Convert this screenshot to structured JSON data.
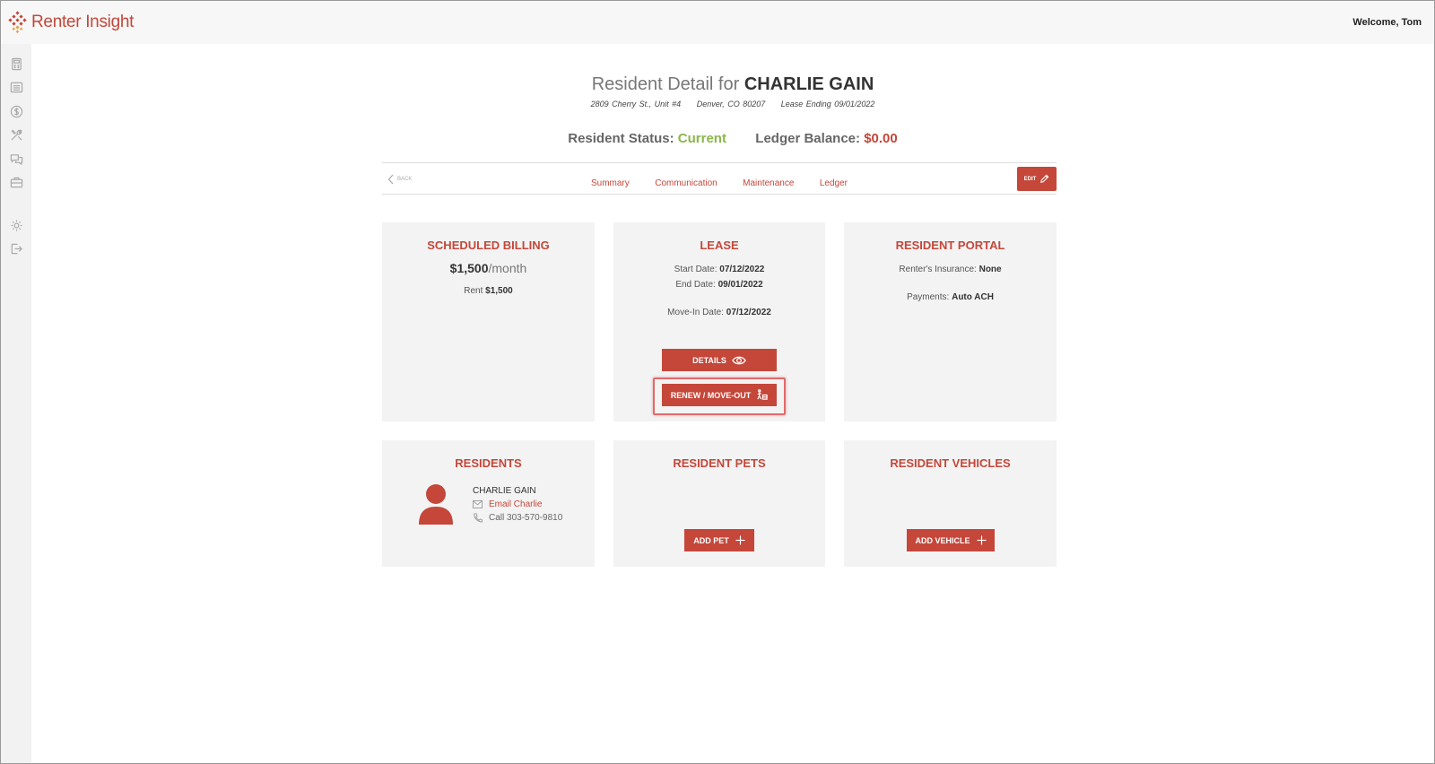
{
  "app": {
    "logo_text": "Renter Insight",
    "welcome": "Welcome, Tom"
  },
  "header": {
    "title_prefix": "Resident Detail for",
    "resident_name": "CHARLIE GAIN",
    "address": "2809 Cherry St., Unit #4",
    "city": "Denver, CO 80207",
    "lease_ending": "Lease Ending 09/01/2022",
    "status_label": "Resident Status:",
    "status_value": "Current",
    "balance_label": "Ledger Balance:",
    "balance_value": "$0.00"
  },
  "nav": {
    "back_label": "BACK",
    "tabs": [
      {
        "label": "Summary"
      },
      {
        "label": "Communication"
      },
      {
        "label": "Maintenance"
      },
      {
        "label": "Ledger"
      }
    ],
    "edit_label": "EDIT"
  },
  "billing": {
    "title": "SCHEDULED BILLING",
    "amount": "$1,500",
    "period": "/month",
    "rent_label": "Rent",
    "rent_value": "$1,500"
  },
  "lease": {
    "title": "LEASE",
    "start_label": "Start Date:",
    "start_value": "07/12/2022",
    "end_label": "End Date:",
    "end_value": "09/01/2022",
    "movein_label": "Move-In Date:",
    "movein_value": "07/12/2022",
    "details_button": "DETAILS",
    "renew_button": "RENEW / MOVE-OUT"
  },
  "portal": {
    "title": "RESIDENT PORTAL",
    "insurance_label": "Renter's Insurance:",
    "insurance_value": "None",
    "payments_label": "Payments:",
    "payments_value": "Auto ACH"
  },
  "residents": {
    "title": "RESIDENTS",
    "name": "CHARLIE GAIN",
    "email_link": "Email Charlie",
    "call_text": "Call 303-570-9810"
  },
  "pets": {
    "title": "RESIDENT PETS",
    "add_button": "ADD PET"
  },
  "vehicles": {
    "title": "RESIDENT VEHICLES",
    "add_button": "ADD VEHICLE"
  },
  "colors": {
    "accent": "#c4473a",
    "status_green": "#8ab74a",
    "card_bg": "#f3f3f3"
  }
}
